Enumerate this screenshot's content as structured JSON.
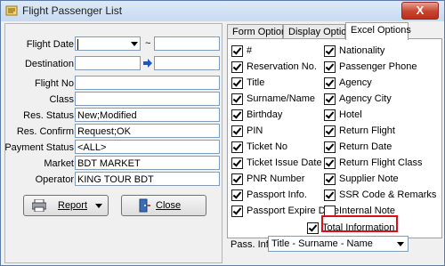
{
  "window": {
    "title": "Flight Passenger List",
    "close_label": "X"
  },
  "filters": {
    "flight_date": {
      "label": "Flight Date",
      "from": "",
      "to": "",
      "separator": "~"
    },
    "destination": {
      "label": "Destination",
      "from": "",
      "to": ""
    },
    "flight_no": {
      "label": "Flight No",
      "value": ""
    },
    "class": {
      "label": "Class",
      "value": ""
    },
    "res_status": {
      "label": "Res. Status",
      "value": "New;Modified"
    },
    "res_confirm": {
      "label": "Res. Confirm",
      "value": "Request;OK"
    },
    "payment_status": {
      "label": "Payment Status",
      "value": "<ALL>"
    },
    "market": {
      "label": "Market",
      "value": "BDT MARKET"
    },
    "operator": {
      "label": "Operator",
      "value": "KING TOUR BDT"
    }
  },
  "buttons": {
    "report": "Report",
    "close": "Close"
  },
  "tabs": [
    {
      "label": "Form Options",
      "active": false
    },
    {
      "label": "Display Options",
      "active": false
    },
    {
      "label": "Excel Options",
      "active": true
    }
  ],
  "excel_options": {
    "left": [
      {
        "label": "#",
        "checked": true
      },
      {
        "label": "Reservation No.",
        "checked": true
      },
      {
        "label": "Title",
        "checked": true
      },
      {
        "label": "Surname/Name",
        "checked": true
      },
      {
        "label": "Birthday",
        "checked": true
      },
      {
        "label": "PIN",
        "checked": true
      },
      {
        "label": "Ticket No",
        "checked": true
      },
      {
        "label": "Ticket Issue Date",
        "checked": true
      },
      {
        "label": "PNR Number",
        "checked": true
      },
      {
        "label": "Passport Info.",
        "checked": true
      },
      {
        "label": "Passport Expire Date",
        "checked": true
      }
    ],
    "right": [
      {
        "label": "Nationality",
        "checked": true
      },
      {
        "label": "Passenger Phone",
        "checked": true
      },
      {
        "label": "Agency",
        "checked": true
      },
      {
        "label": "Agency City",
        "checked": true
      },
      {
        "label": "Hotel",
        "checked": true
      },
      {
        "label": "Return Flight",
        "checked": true
      },
      {
        "label": "Return Date",
        "checked": true
      },
      {
        "label": "Return Flight Class",
        "checked": true
      },
      {
        "label": "Supplier Note",
        "checked": true
      },
      {
        "label": "SSR Code & Remarks & Extr",
        "checked": true
      },
      {
        "label": "Internal Note",
        "checked": false
      }
    ],
    "total_information": {
      "label": "Total Information",
      "checked": true
    }
  },
  "pass_info": {
    "label": "Pass. Info",
    "value": "Title - Surname - Name"
  },
  "colors": {
    "highlight": "#d8101b",
    "close_button": "#c6432d"
  }
}
